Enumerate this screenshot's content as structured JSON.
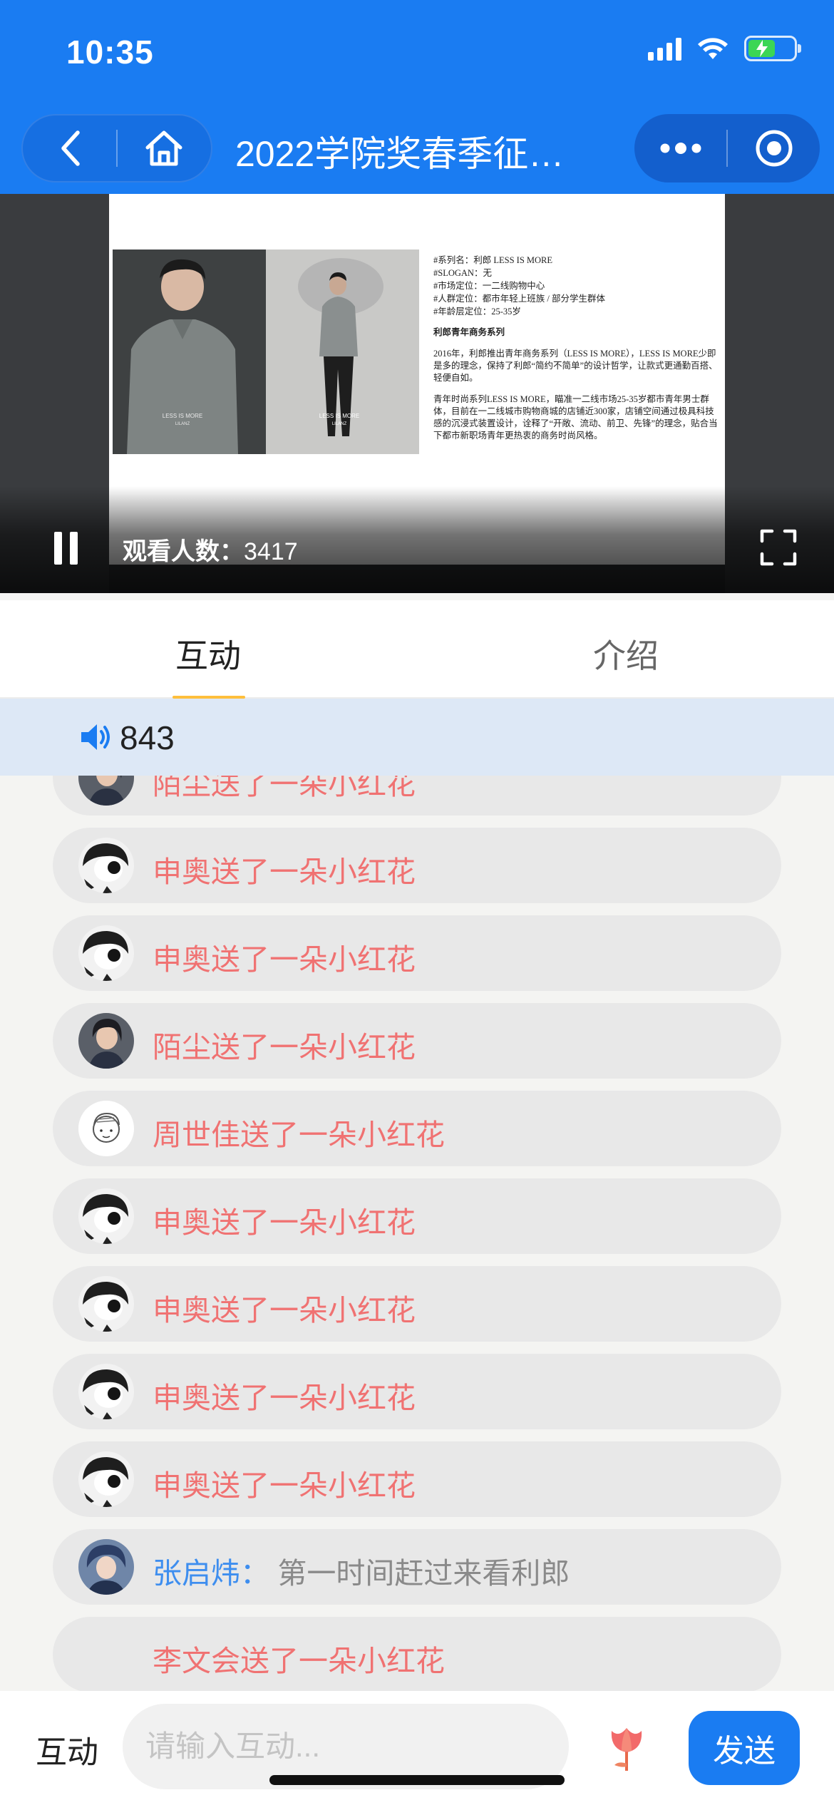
{
  "status_bar": {
    "time": "10:35",
    "battery_level": 0.6,
    "battery_color": "#3bd655"
  },
  "nav": {
    "title": "2022学院奖春季征…",
    "back_icon": "chevron-left-icon",
    "home_icon": "home-icon",
    "more_icon": "more-dots-icon",
    "close_icon": "target-close-icon"
  },
  "video": {
    "viewers_label": "观看人数：",
    "viewers_count": "3417",
    "slide": {
      "photo_label_1": "LESS IS MORE",
      "photo_brand_1": "LILANZ",
      "photo_label_2": "LESS IS MORE",
      "photo_brand_2": "LILANZ",
      "lines": [
        "#系列名：利郎 LESS IS MORE",
        "#SLOGAN：无",
        "#市场定位：一二线购物中心",
        "#人群定位：都市年轻上班族 / 部分学生群体",
        "#年龄层定位：25-35岁"
      ],
      "heading": "利郎青年商务系列",
      "para1": "2016年，利郎推出青年商务系列（LESS IS MORE），LESS IS MORE少即是多的理念，保持了利郎“简约不简单”的设计哲学，让款式更通勤百搭、轻便自如。",
      "para2": "青年时尚系列LESS IS MORE，瞄准一二线市场25-35岁都市青年男士群体，目前在一二线城市购物商城的店铺近300家，店铺空间通过极具科技感的沉浸式装置设计，诠释了“开敞、流动、前卫、先锋”的理念，贴合当下都市新职场青年更热衷的商务时尚风格。"
    }
  },
  "tabs": [
    {
      "label": "互动",
      "active": true
    },
    {
      "label": "介绍",
      "active": false
    }
  ],
  "notice": {
    "text": "843"
  },
  "messages": [
    {
      "avatar": "avatar-girl",
      "text": "陌尘送了一朵小红花"
    },
    {
      "avatar": "avatar-cartoon",
      "text": "申奥送了一朵小红花"
    },
    {
      "avatar": "avatar-cartoon",
      "text": "申奥送了一朵小红花"
    },
    {
      "avatar": "avatar-girl",
      "text": "陌尘送了一朵小红花"
    },
    {
      "avatar": "avatar-sketch",
      "text": "周世佳送了一朵小红花"
    },
    {
      "avatar": "avatar-cartoon",
      "text": "申奥送了一朵小红花"
    },
    {
      "avatar": "avatar-cartoon",
      "text": "申奥送了一朵小红花"
    },
    {
      "avatar": "avatar-cartoon",
      "text": "申奥送了一朵小红花"
    },
    {
      "avatar": "avatar-cartoon",
      "text": "申奥送了一朵小红花"
    }
  ],
  "comment": {
    "avatar": "avatar-anime",
    "user": "张启炜：",
    "text": "第一时间赶过来看利郎"
  },
  "last_message": {
    "text": "李文会送了一朵小红花"
  },
  "bottom": {
    "label": "互动",
    "input_placeholder": "请输入互动...",
    "flower_icon": "tulip-flower-icon",
    "send_label": "发送"
  },
  "colors": {
    "brand_blue": "#1a7cf2",
    "gift_text": "#f07272",
    "user_name": "#3e8eef",
    "tab_underline": "#ffbf3c"
  }
}
